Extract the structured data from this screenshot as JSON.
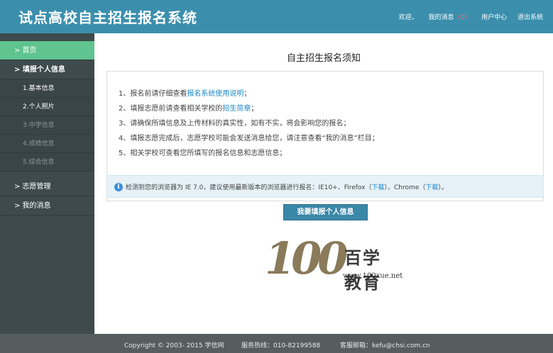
{
  "header": {
    "title": "试点高校自主招生报名系统",
    "nav": {
      "welcome": "欢迎，",
      "messages": "我的消息",
      "message_count": "（0）",
      "user_center": "用户中心",
      "logout": "退出系统"
    }
  },
  "sidebar": {
    "home": "> 首页",
    "fill_info": "> 填报个人信息",
    "sub_items": [
      "1.基本信息",
      "2.个人照片",
      "3.中学信息",
      "4.成绩信息",
      "5.综合信息"
    ],
    "volunteer": "> 志愿管理",
    "my_messages": "> 我的消息"
  },
  "main": {
    "title": "自主招生报名须知",
    "notice": {
      "line1_prefix": "1、报名前请仔细查看",
      "line1_link": "报名系统使用说明",
      "line1_suffix": "；",
      "line2_prefix": "2、填报志愿前请查看相关学校的",
      "line2_link": "招生简章",
      "line2_suffix": "；",
      "line3": "3、请确保所填信息及上传材料的真实性，如有不实，将会影响您的报名；",
      "line4": "4、填报志愿完成后，志愿学校可能会发送消息给您，请注意查看“我的消息”栏目；",
      "line5": "5、相关学校可查看您所填写的报名信息和志愿信息；"
    },
    "browser_info": {
      "icon": "i",
      "prefix": "检测到您的浏览器为 IE 7.0，建议使用最新版本的浏览器进行报名：IE10+、Firefox（",
      "firefox_link": "下载",
      "middle": "）、Chrome（",
      "chrome_link": "下载",
      "suffix": "）。"
    },
    "fill_button": "我要填报个人信息"
  },
  "watermark": {
    "number": "100",
    "chinese": "百学教育",
    "url": "www.100xue.net"
  },
  "footer": {
    "copyright": "Copyright © 2003- 2015 学信网",
    "hotline": "服务热线：010-82199588",
    "email": "客服邮箱：kefu@chsi.com.cn"
  }
}
